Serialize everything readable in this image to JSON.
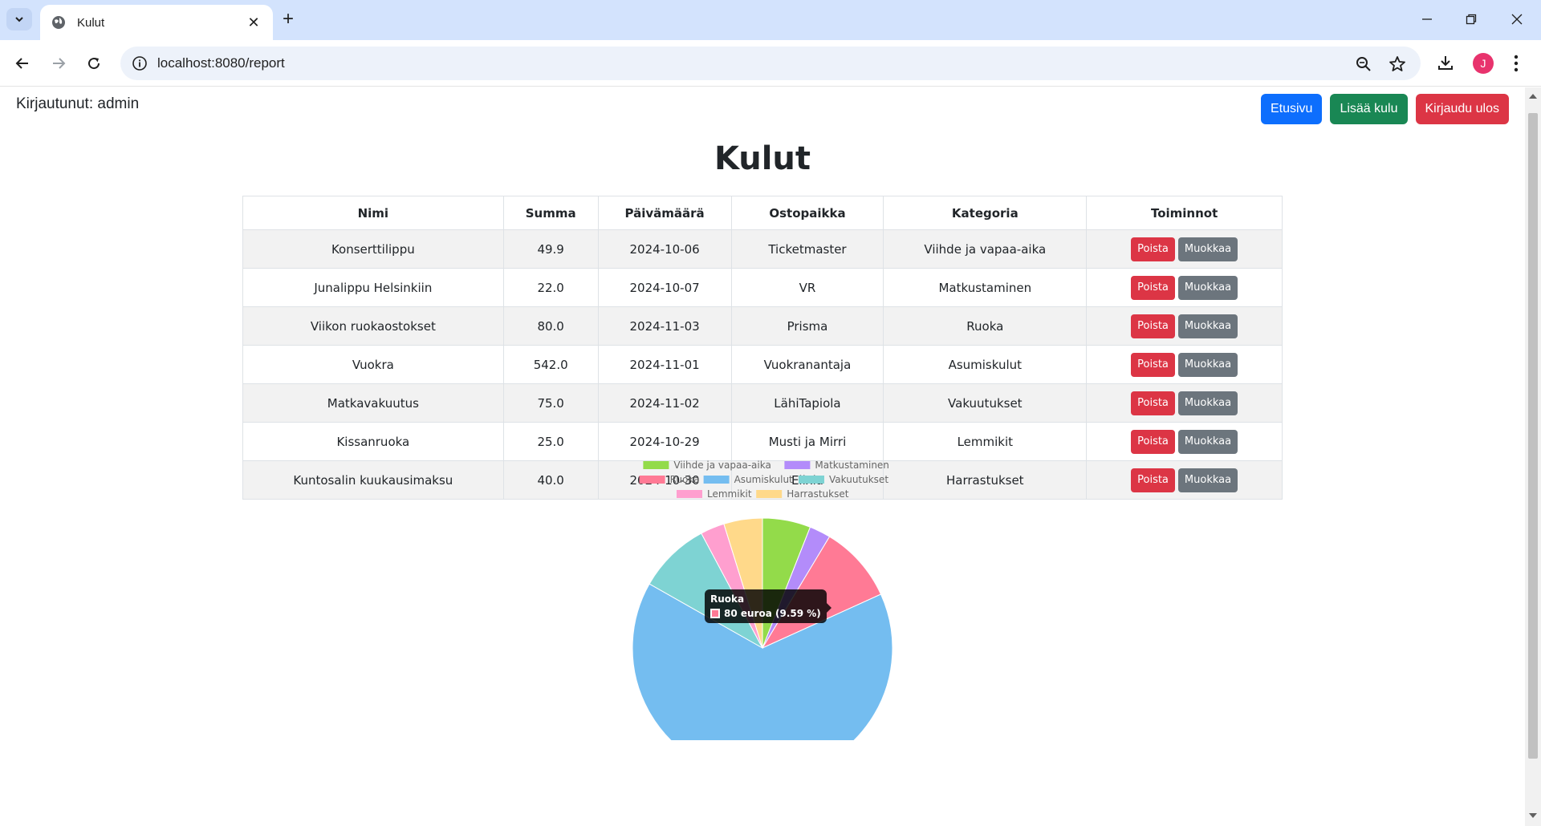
{
  "browser": {
    "tab_title": "Kulut",
    "url": "localhost:8080/report",
    "profile_initial": "J"
  },
  "header": {
    "logged_in": "Kirjautunut: admin",
    "buttons": {
      "home": "Etusivu",
      "add": "Lisää kulu",
      "logout": "Kirjaudu ulos"
    }
  },
  "page_title": "Kulut",
  "table": {
    "columns": [
      "Nimi",
      "Summa",
      "Päivämäärä",
      "Ostopaikka",
      "Kategoria",
      "Toiminnot"
    ],
    "rows": [
      {
        "name": "Konserttilippu",
        "amount": "49.9",
        "date": "2024-10-06",
        "place": "Ticketmaster",
        "category": "Viihde ja vapaa-aika"
      },
      {
        "name": "Junalippu Helsinkiin",
        "amount": "22.0",
        "date": "2024-10-07",
        "place": "VR",
        "category": "Matkustaminen"
      },
      {
        "name": "Viikon ruokaostokset",
        "amount": "80.0",
        "date": "2024-11-03",
        "place": "Prisma",
        "category": "Ruoka"
      },
      {
        "name": "Vuokra",
        "amount": "542.0",
        "date": "2024-11-01",
        "place": "Vuokranantaja",
        "category": "Asumiskulut"
      },
      {
        "name": "Matkavakuutus",
        "amount": "75.0",
        "date": "2024-11-02",
        "place": "LähiTapiola",
        "category": "Vakuutukset"
      },
      {
        "name": "Kissanruoka",
        "amount": "25.0",
        "date": "2024-10-29",
        "place": "Musti ja Mirri",
        "category": "Lemmikit"
      },
      {
        "name": "Kuntosalin kuukausimaksu",
        "amount": "40.0",
        "date": "2024-10-30",
        "place": "Elixia",
        "category": "Harrastukset"
      }
    ],
    "delete_label": "Poista",
    "edit_label": "Muokkaa"
  },
  "chart_data": {
    "type": "pie",
    "categories": [
      "Viihde ja vapaa-aika",
      "Matkustaminen",
      "Ruoka",
      "Asumiskulut",
      "Vakuutukset",
      "Lemmikit",
      "Harrastukset"
    ],
    "values": [
      49.9,
      22.0,
      80.0,
      542.0,
      75.0,
      25.0,
      40.0
    ],
    "colors": [
      "#93db4a",
      "#b38cfa",
      "#ff7a95",
      "#74bdf0",
      "#7ed3d3",
      "#ff9fcf",
      "#ffd98a"
    ],
    "legend_position": "top"
  },
  "tooltip": {
    "title": "Ruoka",
    "body": "80 euroa (9.59 %)",
    "color": "#ff7a95"
  }
}
